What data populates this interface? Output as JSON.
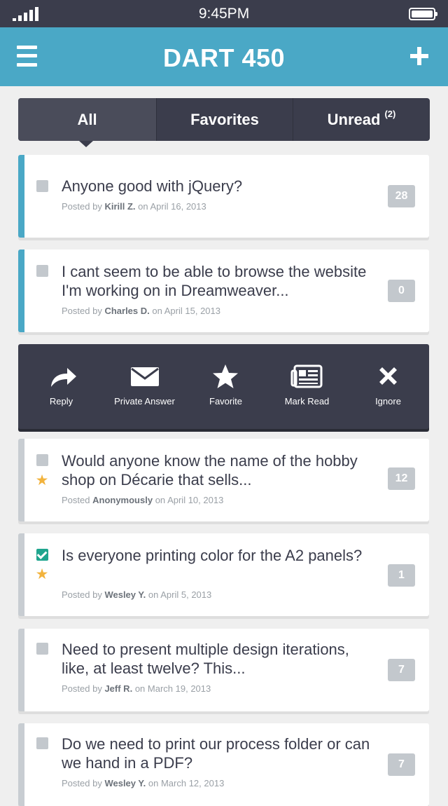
{
  "status_bar": {
    "time": "9:45PM"
  },
  "nav": {
    "title": "DART 450"
  },
  "tabs": [
    {
      "label": "All",
      "active": true
    },
    {
      "label": "Favorites",
      "active": false
    },
    {
      "label": "Unread",
      "badge": "(2)",
      "active": false
    }
  ],
  "posts": [
    {
      "title": "Anyone good with jQuery?",
      "posted_by_prefix": "Posted by",
      "author": "Kirill Z.",
      "date_prefix": "on",
      "date": "April 16, 2013",
      "count": "28",
      "checked": false,
      "favorite": false
    },
    {
      "title": "I cant seem to be able to browse the website I'm working on in Dreamweaver...",
      "posted_by_prefix": "Posted by",
      "author": "Charles D.",
      "date_prefix": "on",
      "date": "April 15, 2013",
      "count": "0",
      "checked": false,
      "favorite": false
    },
    {
      "title": "Would anyone know the name of the hobby shop on Décarie  that sells...",
      "posted_by_prefix": "Posted",
      "author": "Anonymously",
      "date_prefix": "on",
      "date": "April 10, 2013",
      "count": "12",
      "checked": false,
      "favorite": true
    },
    {
      "title": "Is everyone printing color for the A2 panels?",
      "posted_by_prefix": "Posted by",
      "author": "Wesley Y.",
      "date_prefix": "on",
      "date": "April 5, 2013",
      "count": "1",
      "checked": true,
      "favorite": true
    },
    {
      "title": "Need to present multiple design iterations, like, at least twelve? This...",
      "posted_by_prefix": "Posted by",
      "author": "Jeff R.",
      "date_prefix": "on",
      "date": "March 19, 2013",
      "count": "7",
      "checked": false,
      "favorite": false
    },
    {
      "title": "Do we need to print our process folder or can we hand in a PDF?",
      "posted_by_prefix": "Posted by",
      "author": "Wesley Y.",
      "date_prefix": "on",
      "date": "March 12, 2013",
      "count": "7",
      "checked": false,
      "favorite": false
    }
  ],
  "actions": [
    {
      "label": "Reply",
      "icon": "reply-icon"
    },
    {
      "label": "Private Answer",
      "icon": "envelope-icon"
    },
    {
      "label": "Favorite",
      "icon": "star-icon"
    },
    {
      "label": "Mark Read",
      "icon": "newspaper-icon"
    },
    {
      "label": "Ignore",
      "icon": "close-icon"
    }
  ],
  "colors": {
    "accent": "#4aa8c6",
    "dark": "#3b3d4c",
    "check_green": "#1fa58e",
    "star": "#f2b33d",
    "badge_gray": "#c3c8cd"
  }
}
